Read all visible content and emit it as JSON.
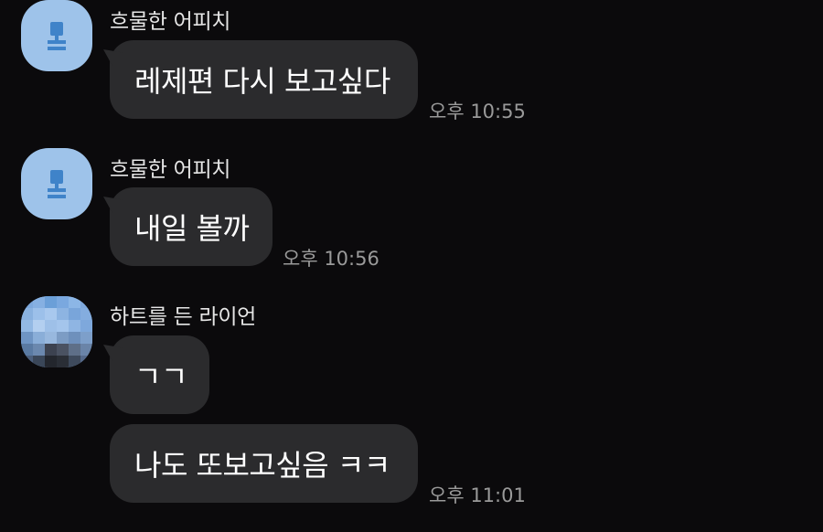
{
  "messages": [
    {
      "sender": "흐물한 어피치",
      "avatar": "default-profile-icon",
      "bubbles": [
        {
          "text": "레제편 다시 보고싶다",
          "time": "오후 10:55"
        }
      ]
    },
    {
      "sender": "흐물한 어피치",
      "avatar": "default-profile-icon",
      "bubbles": [
        {
          "text": "내일 볼까",
          "time": "오후 10:56"
        }
      ]
    },
    {
      "sender": "하트를 든 라이언",
      "avatar": "blurred-profile-photo",
      "bubbles": [
        {
          "text": "ㄱㄱ",
          "time": ""
        },
        {
          "text": "나도 또보고싶음 ㅋㅋ",
          "time": "오후 11:01"
        }
      ]
    }
  ],
  "colors": {
    "background": "#0b0a0c",
    "bubble": "#2b2b2d",
    "default_avatar": "#9ec3ea",
    "timestamp": "#9a9a9a"
  }
}
